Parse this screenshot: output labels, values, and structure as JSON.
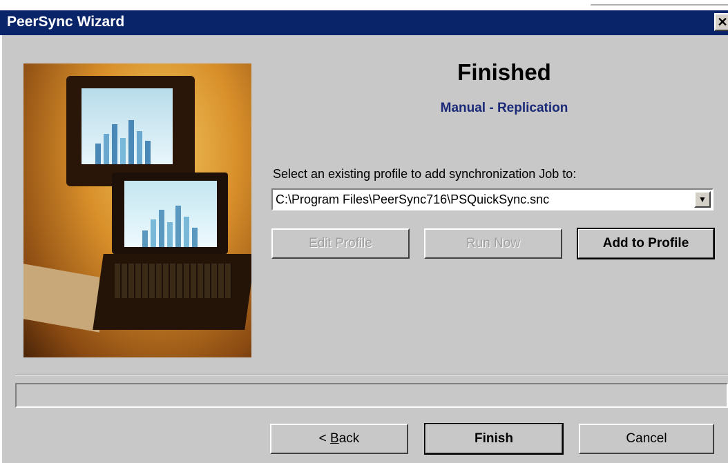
{
  "window": {
    "title": "PeerSync Wizard",
    "close_glyph": "✕",
    "title_bar_color": "#0a246a"
  },
  "content": {
    "heading": "Finished",
    "subheading": "Manual - Replication",
    "select_label": "Select an existing profile to add synchronization Job to:",
    "profile_value": "C:\\Program Files\\PeerSync716\\PSQuickSync.snc",
    "dropdown_glyph": "▼"
  },
  "profile_buttons": {
    "edit": "Edit Profile",
    "run": "Run Now",
    "add": "Add to Profile"
  },
  "nav_buttons": {
    "back_underlined": "B",
    "back_prefix": "< ",
    "back_rest": "ack",
    "finish": "Finish",
    "cancel": "Cancel"
  },
  "colors": {
    "accent": "#1a2a78",
    "dialog_bg": "#c8c8c8"
  }
}
